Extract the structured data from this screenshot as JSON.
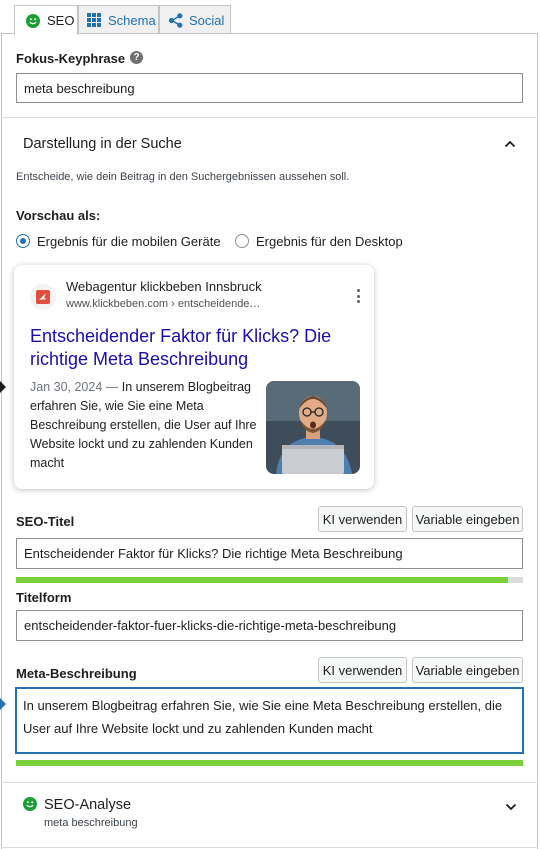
{
  "tabs": [
    {
      "label": "SEO",
      "icon": "smiley-icon",
      "active": true
    },
    {
      "label": "Schema",
      "icon": "grid-icon",
      "active": false
    },
    {
      "label": "Social",
      "icon": "share-icon",
      "active": false
    }
  ],
  "focus_keyphrase": {
    "label": "Fokus-Keyphrase",
    "help_icon": "question-icon",
    "value": "meta beschreibung"
  },
  "search_appearance": {
    "title": "Darstellung in der Suche",
    "description": "Entscheide, wie dein Beitrag in den Suchergebnissen aussehen soll.",
    "preview_as_label": "Vorschau als:",
    "mode_options": [
      {
        "label": "Ergebnis für die mobilen Geräte",
        "checked": true
      },
      {
        "label": "Ergebnis für den Desktop",
        "checked": false
      }
    ]
  },
  "google_preview": {
    "site_name": "Webagentur klickbeben Innsbruck",
    "url": "www.klickbeben.com › entscheidende…",
    "title": "Entscheidender Faktor für Klicks? Die richtige Meta Beschreibung",
    "date": "Jan 30, 2024",
    "separator": " — ",
    "snippet": "In unserem Blogbeitrag erfahren Sie, wie Sie eine Meta Beschreibung erstellen, die User auf Ihre Website lockt und zu zahlenden Kunden macht"
  },
  "seo_title": {
    "label": "SEO-Titel",
    "ai_button": "KI verwenden",
    "variable_button": "Variable eingeben",
    "value": "Entscheidender Faktor für Klicks? Die richtige Meta Beschreibung",
    "progress": 0.97
  },
  "slug": {
    "label": "Titelform",
    "value": "entscheidender-faktor-fuer-klicks-die-richtige-meta-beschreibung"
  },
  "meta_description": {
    "label": "Meta-Beschreibung",
    "ai_button": "KI verwenden",
    "variable_button": "Variable eingeben",
    "value": "In unserem Blogbeitrag erfahren Sie, wie Sie eine Meta Beschreibung erstellen, die User auf Ihre Website lockt und zu zahlenden Kunden macht",
    "progress": 1.0
  },
  "seo_analysis": {
    "title": "SEO-Analyse",
    "subtitle": "meta beschreibung",
    "status_icon": "smiley-icon"
  },
  "colors": {
    "accent": "#2271b1",
    "good": "#7ad03a",
    "link": "#1a0dab",
    "status_good": "#1d9e34"
  }
}
